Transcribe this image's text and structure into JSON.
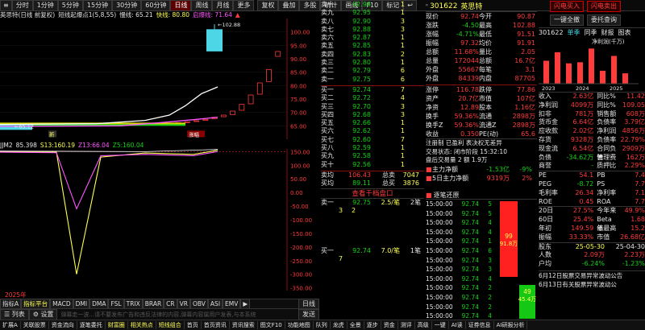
{
  "top_toolbar": {
    "stock_title": "英思特",
    "periods": [
      "分时",
      "1分钟",
      "5分钟",
      "15分钟",
      "30分钟",
      "60分钟",
      "日线",
      "周线",
      "月线",
      "更多"
    ],
    "active_period": "日线",
    "tools": [
      "复权",
      "叠加",
      "多股",
      "统计",
      "画线",
      "F10",
      "标记",
      "↩"
    ]
  },
  "chart_header": {
    "label": "英思特(日线 前复权)",
    "indicator": "短线起爆点1(5,8,55)",
    "slow": "慢线: 65.21",
    "fast": "快线: 80.80",
    "signal": "启爆线: 71.64",
    "extra": "▲"
  },
  "price_axis": [
    "100.00",
    "95.00",
    "90.00",
    "85.00",
    "80.00",
    "75.00",
    "70.00",
    "65.00"
  ],
  "price_annotations": {
    "high": "102.88",
    "low": "65.12",
    "zoom_label": "新",
    "tag": "涨幅"
  },
  "sub_header": {
    "name": "JJM2",
    "vals": [
      "85.398",
      "S13:160.19",
      "Z13:66.04",
      "Z5:160.04"
    ]
  },
  "sub_axis": [
    "150.00",
    "100.00",
    "50.00",
    "0.00",
    "-50.00",
    "-100.00",
    "-150.00",
    "-200.00",
    "-250.00",
    "-300.00",
    "-350.00"
  ],
  "sub_footer": "2025年",
  "bottom_tabs_1": [
    "指标A",
    "指标平台",
    "MACD",
    "DMI",
    "DMA",
    "FSL",
    "TRIX",
    "BRAR",
    "CR",
    "VR",
    "OBV",
    "ASI",
    "EMV",
    "▶"
  ],
  "bottom_tabs_1_right": "日线",
  "bottom_bar_2": {
    "list": "列表",
    "settings": "设置",
    "notice": "弹幕走一波...请不要发布广告和违反法律的内容,弹幕内容属用户发表,与本系统",
    "send": "发送"
  },
  "order_book": {
    "asks": [
      {
        "label": "卖十",
        "price": "92.96",
        "vol": "1"
      },
      {
        "label": "卖九",
        "price": "92.95",
        "vol": "1"
      },
      {
        "label": "卖八",
        "price": "92.90",
        "vol": "3"
      },
      {
        "label": "卖七",
        "price": "92.88",
        "vol": "3"
      },
      {
        "label": "卖六",
        "price": "92.87",
        "vol": "1"
      },
      {
        "label": "卖五",
        "price": "92.85",
        "vol": "1"
      },
      {
        "label": "卖四",
        "price": "92.83",
        "vol": "2"
      },
      {
        "label": "卖三",
        "price": "92.80",
        "vol": "1"
      },
      {
        "label": "卖二",
        "price": "92.79",
        "vol": "6"
      },
      {
        "label": "卖一",
        "price": "92.75",
        "vol": "6"
      }
    ],
    "bids": [
      {
        "label": "买一",
        "price": "92.74",
        "vol": "7"
      },
      {
        "label": "买二",
        "price": "92.72",
        "vol": "4"
      },
      {
        "label": "买三",
        "price": "92.70",
        "vol": "3"
      },
      {
        "label": "买四",
        "price": "92.68",
        "vol": "3"
      },
      {
        "label": "买五",
        "price": "92.66",
        "vol": "1"
      },
      {
        "label": "买六",
        "price": "92.62",
        "vol": "1"
      },
      {
        "label": "买七",
        "price": "92.60",
        "vol": "7"
      },
      {
        "label": "买八",
        "price": "92.59",
        "vol": "1"
      },
      {
        "label": "买九",
        "price": "92.58",
        "vol": "1"
      },
      {
        "label": "买十",
        "price": "92.56",
        "vol": "1"
      }
    ],
    "totals": [
      {
        "label": "卖均",
        "price": "106.43",
        "tlabel": "总卖",
        "vol": "7047"
      },
      {
        "label": "买均",
        "price": "89.11",
        "tlabel": "总买",
        "vol": "3876"
      }
    ],
    "queue_title": "查看千档盘口",
    "queue": [
      {
        "label": "卖一",
        "price": "92.75",
        "q": "2.5/笔",
        "n": "2笔",
        "items": [
          "3",
          "2"
        ]
      },
      {
        "label": "买一",
        "price": "92.74",
        "q": "7.0/笔",
        "n": "1笔",
        "items": [
          "7"
        ]
      }
    ]
  },
  "quote": {
    "code": "301622",
    "name": "英思特",
    "rows": [
      [
        "现价",
        "92.74",
        "今开",
        "90.87"
      ],
      [
        "涨跌",
        "-4.50",
        "最高",
        "102.88"
      ],
      [
        "涨幅",
        "-4.71%",
        "最低",
        "91.51"
      ],
      [
        "振幅",
        "97.32",
        "均价",
        "91.91"
      ],
      [
        "总额",
        "11.68%",
        "量比",
        "2.05"
      ],
      [
        "总量",
        "172044",
        "总额",
        "16.7亿"
      ],
      [
        "外盘",
        "55667",
        "每笔",
        "3.1"
      ],
      [
        "外盘",
        "84339",
        "内盘",
        "87705"
      ]
    ],
    "rows2": [
      [
        "涨停",
        "116.78",
        "跌停",
        "77.86"
      ],
      [
        "资产",
        "20.7亿",
        "市值",
        "107亿"
      ],
      [
        "净资",
        "12.89",
        "股本",
        "1.16亿"
      ],
      [
        "换手",
        "59.36%",
        "流通",
        "2898万"
      ],
      [
        "换手Z",
        "59.36%",
        "流通Z",
        "2898万"
      ],
      [
        "收益",
        "0.350",
        "PE(动)",
        "65.6"
      ]
    ],
    "notes": [
      "注册制 已盈利 表决权无差异",
      "交易状态: 闭市阶段 15:32:10",
      "盘后交易量 2 额 1.9万"
    ],
    "flows": [
      {
        "label": "主力净额",
        "value": "-1.53亿",
        "pct": "-9%"
      },
      {
        "label": "5日主力净额",
        "value": "9319万",
        "pct": "2%"
      }
    ]
  },
  "ticks": {
    "title": "逐笔还原",
    "rows": [
      [
        "15:00:00",
        "92.74",
        "5"
      ],
      [
        "15:00:00",
        "92.74",
        "5"
      ],
      [
        "15:00:00",
        "92.74",
        "4"
      ],
      [
        "15:00:00",
        "92.74",
        "4"
      ],
      [
        "15:00:00",
        "92.74",
        "1"
      ],
      [
        "15:00:00",
        "92.74",
        "6"
      ],
      [
        "15:00:00",
        "92.74",
        "3"
      ],
      [
        "15:00:00",
        "92.74",
        "3"
      ],
      [
        "15:00:00",
        "92.74",
        "4"
      ],
      [
        "15:00:00",
        "92.74",
        "2"
      ],
      [
        "15:00:00",
        "92.74",
        "2"
      ],
      [
        "15:00:00",
        "92.74",
        "2"
      ],
      [
        "15:00:00",
        "92.74",
        "4"
      ],
      [
        "15:00:00",
        "92.74",
        "4"
      ],
      [
        "15:00:00",
        "92.74",
        "1"
      ],
      [
        "15:00:00",
        "92.74",
        "1"
      ],
      [
        "15:00:00",
        "92.74",
        "1"
      ],
      [
        "15:00:00",
        "92.74",
        "3"
      ],
      [
        "15:00:00",
        "92.74",
        "2"
      ],
      [
        "15:00:00",
        "92.74",
        "1"
      ],
      [
        "15:00:00",
        "92.74",
        "1"
      ],
      [
        "15:00:00",
        "92.74",
        "1"
      ],
      [
        "15:00:00",
        "92.74",
        "1"
      ]
    ],
    "bar_labels": {
      "red_top": "99",
      "red_bot": "91.8万",
      "green_top": "49",
      "green_bot": "45.4万"
    }
  },
  "right_panel": {
    "buttons": [
      "闪电买入",
      "闪电卖出",
      "一键全撤",
      "委托查询"
    ],
    "tabs": [
      "301622",
      "单季",
      "同季",
      "财报",
      "图表"
    ],
    "chart_title": "净利润(千万)",
    "years": [
      "2023",
      "2024",
      "2025"
    ],
    "bars": [
      {
        "h": 0.62,
        "color": "#ff3b3b"
      },
      {
        "h": 0.85,
        "color": "#ff3b3b"
      },
      {
        "h": 0.55,
        "color": "#ff3b3b"
      },
      {
        "h": 0.58,
        "color": "#ff3b3b"
      },
      {
        "h": 0.95,
        "color": "#ff3b3b"
      },
      {
        "h": 0.35,
        "color": "#ff3b3b"
      },
      {
        "h": 0.75,
        "color": "#ff3b3b"
      },
      {
        "h": 0.28,
        "color": "#ff3b3b"
      }
    ],
    "fin": [
      [
        "收入",
        "2.63亿",
        "同比%",
        "11.42"
      ],
      [
        "净利润",
        "4099万",
        "同比%",
        "109.05"
      ],
      [
        "扣非",
        "781万",
        "销售额",
        "608万"
      ],
      [
        "货币金",
        "6.64亿",
        "负债率",
        "3.79亿"
      ],
      [
        "应收款",
        "2.02亿",
        "净利润",
        "4856万"
      ],
      [
        "存货",
        "9328万",
        "负债率",
        "22.79%"
      ],
      [
        "现金流",
        "6.54亿",
        "合同负债",
        "2909万"
      ],
      [
        "负债",
        "-34.62万",
        "管理费",
        "162万"
      ],
      [
        "商誉",
        "-",
        "质押比",
        "2.29%"
      ]
    ],
    "ratios": [
      [
        "PE",
        "54.1",
        "PB",
        "7.4"
      ],
      [
        "PEG",
        "-8.72",
        "PS",
        "7.7"
      ],
      [
        "毛利率",
        "26.34",
        "净利率",
        "7.1"
      ],
      [
        "ROE",
        "0.45",
        "ROA",
        "7.7"
      ]
    ],
    "perf": [
      [
        "20日",
        "27.5%",
        "今年来",
        "49.9%"
      ],
      [
        "60日",
        "25.4%",
        "Beta值",
        "1.68"
      ],
      [
        "年初",
        "149.59",
        "年最高",
        "15.2"
      ],
      [
        "振幅",
        "33.33%",
        "市值",
        "26.68亿"
      ]
    ],
    "dividend_header": [
      "股东",
      "25-05-30",
      "25-04-30"
    ],
    "dividend": [
      [
        "人数",
        "2.09万",
        "2.23万"
      ],
      [
        "户均",
        "-6.24%",
        "-1.23%"
      ]
    ],
    "news": [
      "6月12日股票交易异常波动公告",
      "6月13日有关股票异常波动公"
    ]
  },
  "status_bar": [
    "扩展A",
    "关联股票",
    "资金流向",
    "逐笔委托",
    "财富圈",
    "相关热点",
    "短线组合",
    "首页",
    "首页资讯",
    "资讯搜索",
    "图文F10",
    "功能地图",
    "队列",
    "龙虎",
    "全景",
    "逐步",
    "资金",
    "测评",
    "高级",
    "一键",
    "AI读",
    "证券信息",
    "AI研报分析"
  ],
  "colors": {
    "up": "#ff3b3b",
    "down": "#16d116",
    "accent": "#ffff54",
    "cyan": "#4cd6e6",
    "magenta": "#ff55ff"
  }
}
